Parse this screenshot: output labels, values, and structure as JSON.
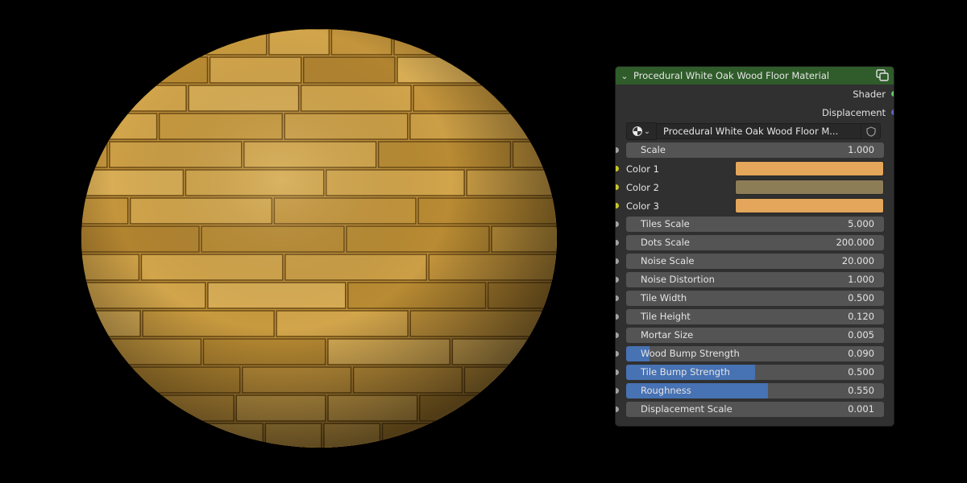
{
  "node": {
    "title": "Procedural White Oak Wood Floor Material",
    "header_color": "#2f5c2a",
    "outputs": [
      {
        "label": "Shader",
        "socket_color": "#63c763"
      },
      {
        "label": "Displacement",
        "socket_color": "#6363c7"
      }
    ],
    "material_name": "Procedural White Oak Wood Floor M...",
    "inputs": {
      "scale": {
        "label": "Scale",
        "value": "1.000"
      },
      "color1": {
        "label": "Color 1",
        "color": "#e3a65a"
      },
      "color2": {
        "label": "Color 2",
        "color": "#8c7d57"
      },
      "color3": {
        "label": "Color 3",
        "color": "#e3a65a"
      },
      "tiles_scale": {
        "label": "Tiles Scale",
        "value": "5.000"
      },
      "dots_scale": {
        "label": "Dots Scale",
        "value": "200.000"
      },
      "noise_scale": {
        "label": "Noise Scale",
        "value": "20.000"
      },
      "noise_distortion": {
        "label": "Noise Distortion",
        "value": "1.000"
      },
      "tile_width": {
        "label": "Tile Width",
        "value": "0.500"
      },
      "tile_height": {
        "label": "Tile Height",
        "value": "0.120"
      },
      "mortar_size": {
        "label": "Mortar Size",
        "value": "0.005"
      },
      "wood_bump_strength": {
        "label": "Wood Bump Strength",
        "value": "0.090",
        "fill_fraction": 0.09
      },
      "tile_bump_strength": {
        "label": "Tile Bump Strength",
        "value": "0.500",
        "fill_fraction": 0.5
      },
      "roughness": {
        "label": "Roughness",
        "value": "0.550",
        "fill_fraction": 0.55
      },
      "displacement_scale": {
        "label": "Displacement Scale",
        "value": "0.001"
      }
    }
  },
  "icons": {
    "collapse": "chevron-down-icon",
    "node_group": "node-group-icon",
    "material": "material-sphere-icon",
    "fake_user": "shield-icon"
  },
  "preview": {
    "subject": "wood-floor-sphere",
    "plank_color": "#c79a3e",
    "background": "#000000"
  }
}
